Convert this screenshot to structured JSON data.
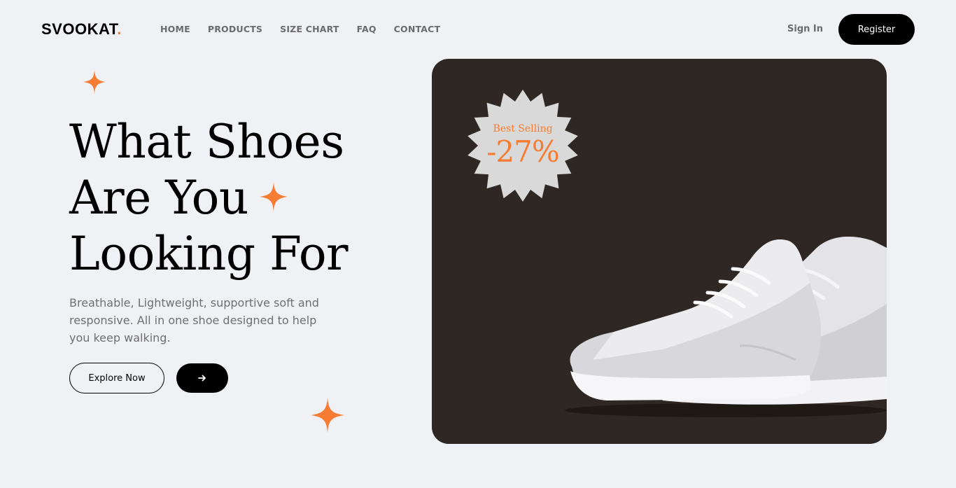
{
  "brand": {
    "name": "SVOOKAT",
    "dot": "."
  },
  "nav": {
    "items": [
      {
        "label": "HOME"
      },
      {
        "label": "PRODUCTS"
      },
      {
        "label": "SIZE CHART"
      },
      {
        "label": "FAQ"
      },
      {
        "label": "CONTACT"
      }
    ],
    "signin_label": "Sign In",
    "register_label": "Register"
  },
  "hero": {
    "headline_lines": [
      "What Shoes",
      "Are You",
      "Looking For"
    ],
    "description": "Breathable, Lightweight, supportive soft and responsive. All in one shoe designed to help you keep walking.",
    "explore_label": "Explore Now",
    "arrow_icon": "arrow-right-icon"
  },
  "promo": {
    "badge_label": "Best Selling",
    "discount": "-27%"
  },
  "colors": {
    "accent": "#f57c32",
    "background": "#f0f1f5",
    "card": "#2e2723",
    "badge": "#d9d9d9"
  }
}
